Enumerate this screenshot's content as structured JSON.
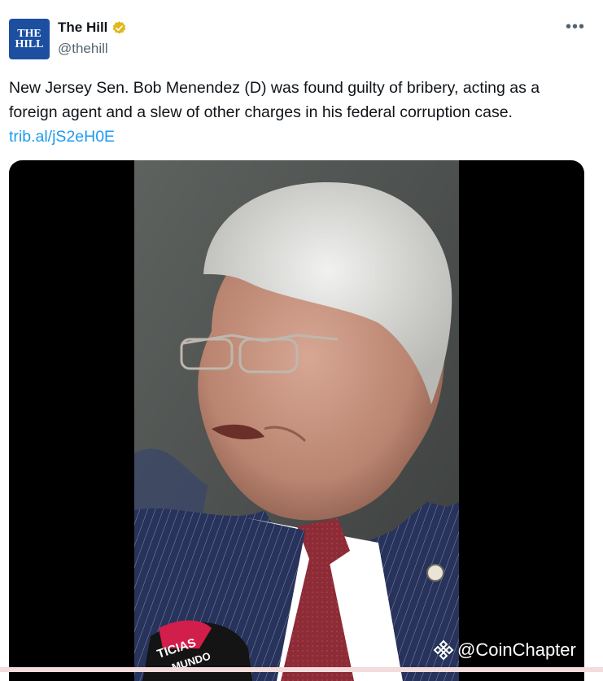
{
  "account": {
    "avatar_line1": "THE",
    "avatar_line2": "HILL",
    "display_name": "The Hill",
    "handle": "@thehill",
    "verified_color": "#e2b719"
  },
  "more_label": "•••",
  "tweet": {
    "text": "New Jersey Sen. Bob Menendez (D) was found guilty of bribery, acting as a foreign agent and a slew of other charges in his federal corruption case. ",
    "link": "trib.al/jS2eH0E"
  },
  "video": {
    "mic_text_line1": "TICIAS",
    "mic_text_line2": "MUNDO"
  },
  "watermark": {
    "text": "@CoinChapter",
    "icon": "binance-diamond-icon"
  },
  "colors": {
    "link": "#1d9bf0",
    "brand": "#1c4fa0"
  }
}
